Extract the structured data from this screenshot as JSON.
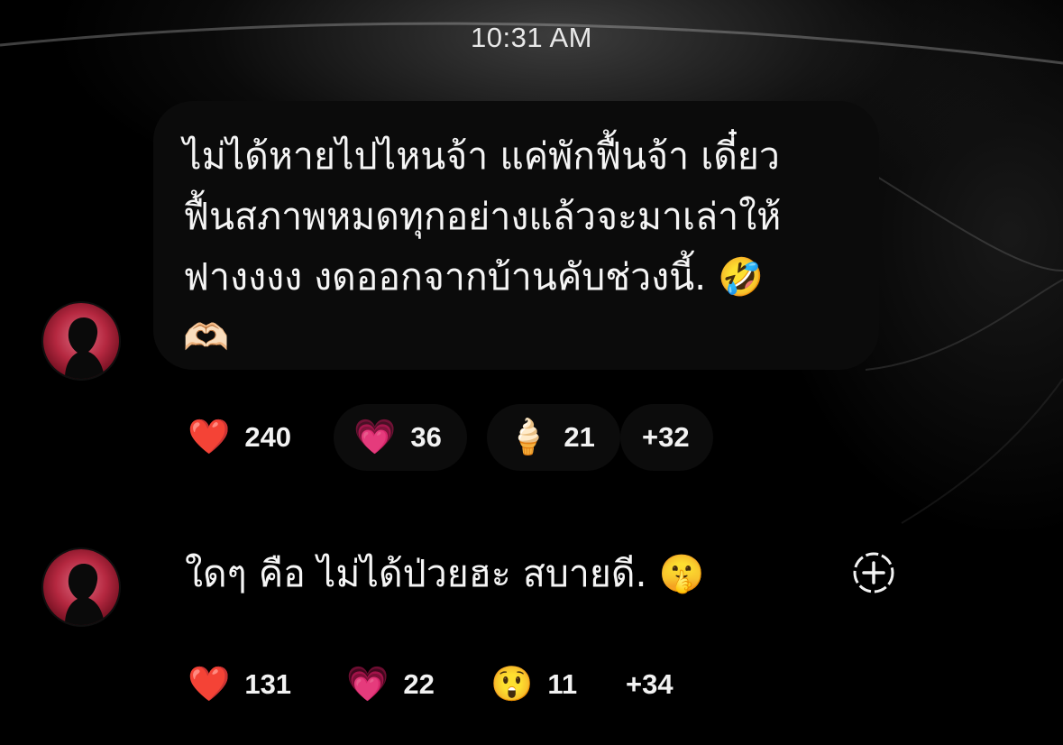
{
  "status_bar": {
    "time": "10:31 AM"
  },
  "messages": [
    {
      "text": "ไม่ได้หายไปไหนจ้า แค่พักฟื้นจ้า เดี๋ยว\nฟื้นสภาพหมดทุกอย่างแล้วจะมาเล่าให้\nฟางงงง งดออกจากบ้านคับช่วงนี้. 🤣\n🫶🏻",
      "reactions": [
        {
          "emoji": "❤️",
          "count": "240"
        },
        {
          "emoji": "💗",
          "count": "36"
        },
        {
          "emoji": "🍦",
          "count": "21"
        }
      ],
      "more": "+32"
    },
    {
      "text": "ใดๆ คือ ไม่ได้ป่วยฮะ สบายดี. 🤫",
      "reactions": [
        {
          "emoji": "❤️",
          "count": "131"
        },
        {
          "emoji": "💗",
          "count": "22"
        },
        {
          "emoji": "😲",
          "count": "11"
        }
      ],
      "more": "+34"
    }
  ],
  "icons": {
    "avatar": "person-silhouette-icon",
    "add_reaction": "add-reaction-icon"
  },
  "colors": {
    "background": "#000000",
    "bubble": "#0b0b0b",
    "avatar_accent": "#b52840",
    "text": "#f5f5f5"
  }
}
